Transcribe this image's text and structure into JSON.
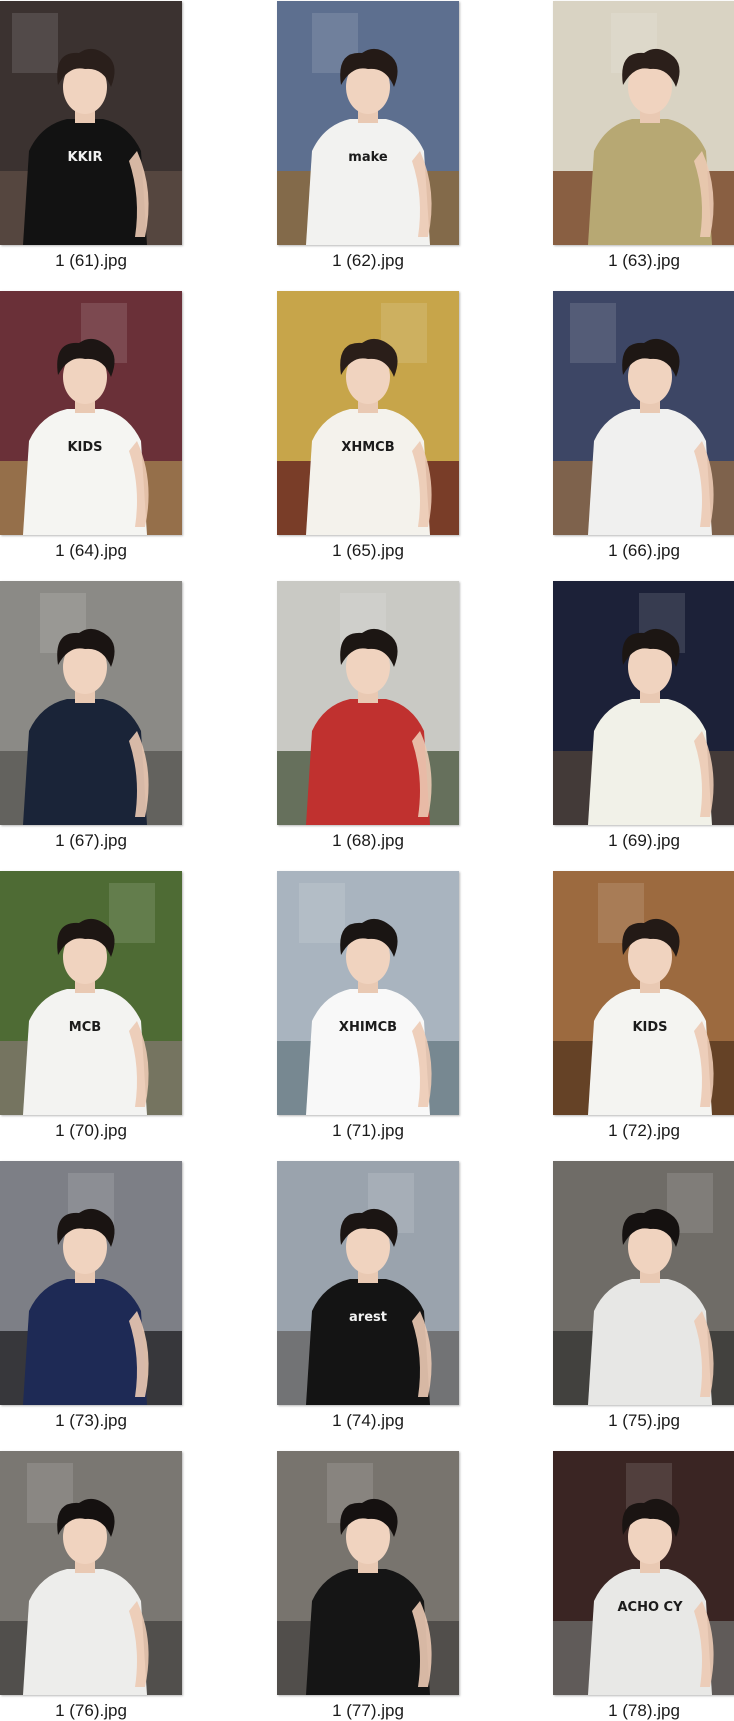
{
  "files": [
    {
      "name": "1 (61).jpg",
      "shirt_text": "KKIR",
      "bg": "#3b3230",
      "floor": "#5a4a42",
      "shirt": "#121212",
      "hair": "#2a1f1b"
    },
    {
      "name": "1 (62).jpg",
      "shirt_text": "make",
      "bg": "#5d6f8f",
      "floor": "#8a6a3e",
      "shirt": "#f2f2f0",
      "hair": "#241a16"
    },
    {
      "name": "1 (63).jpg",
      "shirt_text": "",
      "bg": "#d9d3c3",
      "floor": "#7a4a2c",
      "shirt": "#b7a873",
      "hair": "#2b1f1a"
    },
    {
      "name": "1 (64).jpg",
      "shirt_text": "KIDS",
      "bg": "#6a3038",
      "floor": "#9c7a4d",
      "shirt": "#f5f5f2",
      "hair": "#1d1614"
    },
    {
      "name": "1 (65).jpg",
      "shirt_text": "XHMCB",
      "bg": "#c7a54a",
      "floor": "#6b2a22",
      "shirt": "#f4f2ec",
      "hair": "#2a1e19"
    },
    {
      "name": "1 (66).jpg",
      "shirt_text": "",
      "bg": "#3d4665",
      "floor": "#8a6748",
      "shirt": "#f0f0ef",
      "hair": "#1e1714"
    },
    {
      "name": "1 (67).jpg",
      "shirt_text": "",
      "bg": "#8b8a86",
      "floor": "#5c5a57",
      "shirt": "#1a2438",
      "hair": "#1a1412"
    },
    {
      "name": "1 (68).jpg",
      "shirt_text": "",
      "bg": "#c9c9c4",
      "floor": "#55604a",
      "shirt": "#c0312f",
      "hair": "#1c1613"
    },
    {
      "name": "1 (69).jpg",
      "shirt_text": "",
      "bg": "#1c2138",
      "floor": "#4a3e38",
      "shirt": "#f1f1e8",
      "hair": "#1c1613"
    },
    {
      "name": "1 (70).jpg",
      "shirt_text": "MCB",
      "bg": "#4e6b34",
      "floor": "#7d7569",
      "shirt": "#f3f3f1",
      "hair": "#1d1613"
    },
    {
      "name": "1 (71).jpg",
      "shirt_text": "XHIMCB",
      "bg": "#a9b4bf",
      "floor": "#6e8088",
      "shirt": "#f8f8f8",
      "hair": "#1a1513"
    },
    {
      "name": "1 (72).jpg",
      "shirt_text": "KIDS",
      "bg": "#9c6a3f",
      "floor": "#5c3b22",
      "shirt": "#f4f4f1",
      "hair": "#231a16"
    },
    {
      "name": "1 (73).jpg",
      "shirt_text": "",
      "bg": "#7d7f86",
      "floor": "#2a2a2e",
      "shirt": "#1e2a55",
      "hair": "#1a1412"
    },
    {
      "name": "1 (74).jpg",
      "shirt_text": "arest",
      "bg": "#9aa3ad",
      "floor": "#6b6b6b",
      "shirt": "#141414",
      "hair": "#1b1513"
    },
    {
      "name": "1 (75).jpg",
      "shirt_text": "",
      "bg": "#6f6c67",
      "floor": "#3b3937",
      "shirt": "#e7e7e5",
      "hair": "#151110"
    },
    {
      "name": "1 (76).jpg",
      "shirt_text": "",
      "bg": "#7a7772",
      "floor": "#4a4845",
      "shirt": "#ededeb",
      "hair": "#151110"
    },
    {
      "name": "1 (77).jpg",
      "shirt_text": "",
      "bg": "#78746e",
      "floor": "#4a4845",
      "shirt": "#151515",
      "hair": "#151110"
    },
    {
      "name": "1 (78).jpg",
      "shirt_text": "ACHO CY",
      "bg": "#3a2523",
      "floor": "#676563",
      "shirt": "#e8e8e6",
      "hair": "#1a1412"
    }
  ]
}
